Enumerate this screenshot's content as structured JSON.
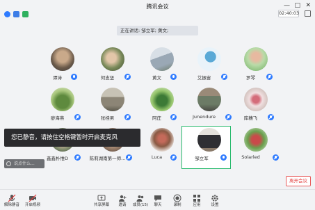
{
  "window": {
    "title": "腾讯会议",
    "timer": "02:40:03"
  },
  "speaking_banner": "正在讲话: 邹立军; 黄文;",
  "participants": [
    {
      "name": "谭诗",
      "muted": false
    },
    {
      "name": "何志坚",
      "muted": true
    },
    {
      "name": "黄文",
      "muted": false
    },
    {
      "name": "艾振宙",
      "muted": true
    },
    {
      "name": "罗琴",
      "muted": true
    },
    {
      "name": "廖海燕",
      "muted": true
    },
    {
      "name": "张桂男",
      "muted": true
    },
    {
      "name": "阿庄",
      "muted": true
    },
    {
      "name": "Junendure",
      "muted": true
    },
    {
      "name": "库穗飞",
      "muted": true
    },
    {
      "name": "鑫鑫朴惟D",
      "muted": true
    },
    {
      "name": "陈莉湖南第一师...",
      "muted": true
    },
    {
      "name": "Luca",
      "muted": true
    },
    {
      "name": "邹立军",
      "muted": false
    },
    {
      "name": "Solarled",
      "muted": true
    }
  ],
  "toast": "您已静音，请按住空格键暂时开启麦克风",
  "chat_placeholder": "说点什么...",
  "toolbar": {
    "unmute": "解除静音",
    "video": "开启视频",
    "share": "共享屏幕",
    "invite": "邀请",
    "members": "成员(15)",
    "chat": "聊天",
    "record": "录制",
    "apps": "应用",
    "settings": "设置"
  },
  "leave_button": "离开会议",
  "colors": {
    "accent_blue": "#2f7bff",
    "active_green": "#26b96b",
    "leave_red": "#e23b3b"
  }
}
